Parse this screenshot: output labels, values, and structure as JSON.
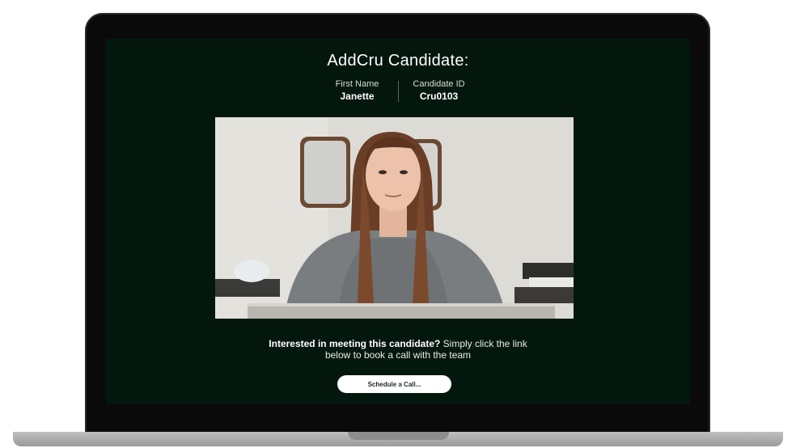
{
  "page": {
    "title": "AddCru Candidate:",
    "fields": [
      {
        "label": "First Name",
        "value": "Janette"
      },
      {
        "label": "Candidate ID",
        "value": "Cru0103"
      }
    ],
    "cta_bold": "Interested in meeting this candidate?",
    "cta_line1_rest": " Simply click the link",
    "cta_line2": "below to book a call with the team",
    "button_label": "Schedule a Call..."
  },
  "colors": {
    "screen_bg": "#04170f",
    "button_bg": "#ffffff",
    "text": "#ffffff"
  },
  "icons": {
    "video": "candidate-video-still"
  }
}
